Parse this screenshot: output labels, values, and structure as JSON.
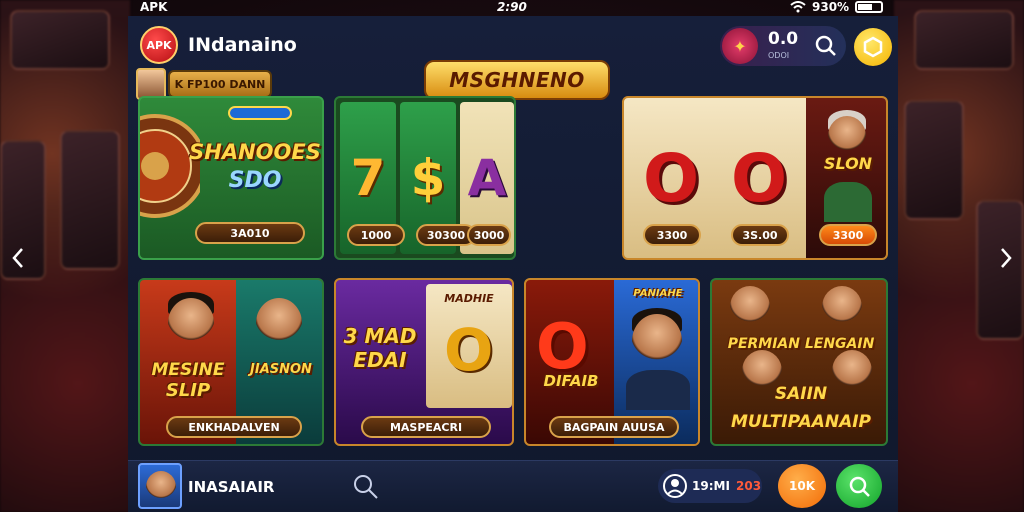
{
  "status_bar": {
    "carrier": "APK",
    "time": "2:90",
    "battery": "930%"
  },
  "header": {
    "logo_text": "APK",
    "app_title": "INdanaino",
    "wallet_value": "0.0",
    "wallet_sub": "ODOI"
  },
  "banner": {
    "title": "MSGHNENO"
  },
  "promo": {
    "label": "K FP100 DANN"
  },
  "cards": {
    "card1": {
      "title_line1": "SHANOOES",
      "title_line2": "SDO",
      "tag": "",
      "pill": "3A010"
    },
    "card2": {
      "reel1": "7",
      "reel2": "$",
      "reel3": "A",
      "pill1": "1000",
      "pill2": "30300",
      "pill3": "3000"
    },
    "card3": {
      "reel1": "O",
      "reel2": "O",
      "side_title": "SLON",
      "pill1": "3300",
      "pill2": "3S.00",
      "pill3": "3300"
    },
    "card4": {
      "title1_line1": "MESINE",
      "title1_line2": "SLIP",
      "title2": "JIASNON",
      "pill": "ENKHADALVEN"
    },
    "card5": {
      "title_line1": "3 MAD",
      "title_line2": "EDAI",
      "badge": "MADHIE",
      "pill": "MASPEACRI"
    },
    "card6": {
      "title": "DIFAIB",
      "badge": "PANIAHE",
      "pill": "BAGPAIN AUUSA"
    },
    "card7": {
      "title_top": "PERMIAN LENGAIN",
      "title_line1": "SAIIN",
      "title_line2": "MULTIPAANAIP"
    }
  },
  "bottom_bar": {
    "username": "INASAIAIR",
    "balance_value": "19:MI",
    "balance_value2": "203",
    "orange_button": "10K"
  },
  "colors": {
    "panel": "#161f3a",
    "accent_gold": "#ffd84a",
    "accent_orange": "#f26b06",
    "accent_green": "#12a32a"
  }
}
